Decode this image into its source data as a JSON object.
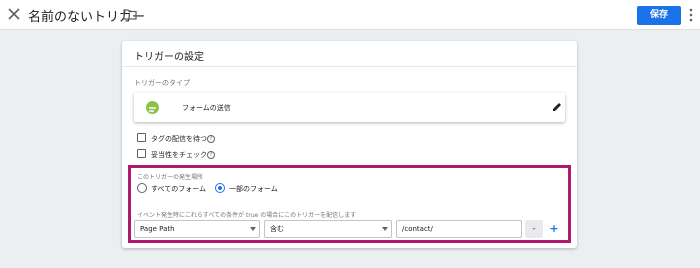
{
  "header": {
    "title": "名前のないトリガー",
    "save_label": "保存",
    "accent_color": "#1a73e8"
  },
  "panel": {
    "title": "トリガーの設定",
    "type_label": "トリガーのタイプ",
    "trigger_type": "フォームの送信",
    "checkboxes": [
      {
        "label": "タグの配信を待つ",
        "checked": false
      },
      {
        "label": "妥当性をチェック",
        "checked": false
      }
    ],
    "fire_on_label": "このトリガーの発生場所",
    "fire_options": [
      {
        "label": "すべてのフォーム",
        "selected": false
      },
      {
        "label": "一部のフォーム",
        "selected": true
      }
    ],
    "condition_label": "イベント発生時にこれらすべての条件が true の場合にこのトリガーを配信します",
    "condition": {
      "variable": "Page Path",
      "operator": "含む",
      "value": "/contact/"
    },
    "minus_label": "-",
    "plus_label": "+"
  },
  "highlight_color": "#b0176f"
}
